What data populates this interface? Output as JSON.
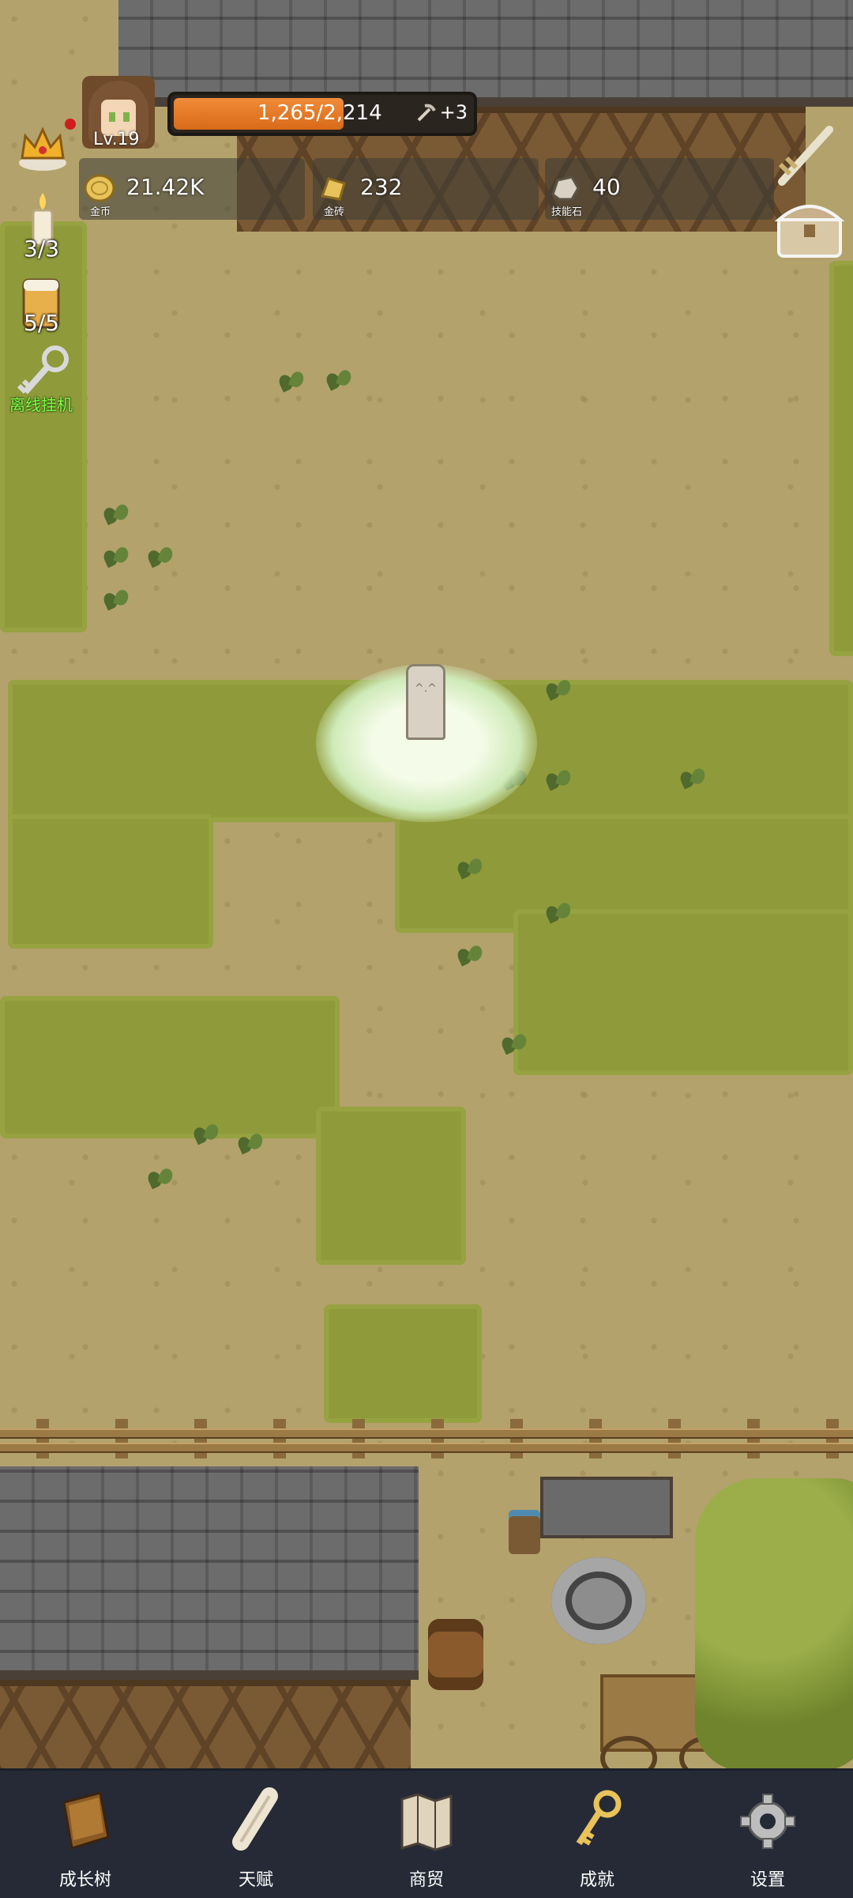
{
  "hud": {
    "level": "Lv.19",
    "exp_text": "1,265/2,214",
    "exp_fraction": 0.571,
    "exp_bonus": "+3"
  },
  "resources": [
    {
      "name": "gold",
      "value": "21.42K",
      "caption": "金币",
      "icon": "gold-coin-icon"
    },
    {
      "name": "gold-brick",
      "value": "232",
      "caption": "金砖",
      "icon": "gold-bar-icon"
    },
    {
      "name": "skill-stone",
      "value": "40",
      "caption": "技能石",
      "icon": "skill-stone-icon"
    }
  ],
  "left_panel": {
    "candle_count": "3/3",
    "beer_count": "5/5",
    "idle_label": "离线挂机"
  },
  "nav": {
    "tabs": [
      {
        "label": "成长树",
        "icon": "book-icon"
      },
      {
        "label": "天赋",
        "icon": "scroll-icon"
      },
      {
        "label": "商贸",
        "icon": "map-icon"
      },
      {
        "label": "成就",
        "icon": "key-icon"
      },
      {
        "label": "设置",
        "icon": "gear-icon"
      }
    ]
  },
  "colors": {
    "exp_fill": "#e8782a",
    "nav_bg": "#252a36",
    "idle_label": "#7dff4a",
    "grass": "#8f9a3a",
    "dirt": "#b3a26c"
  }
}
